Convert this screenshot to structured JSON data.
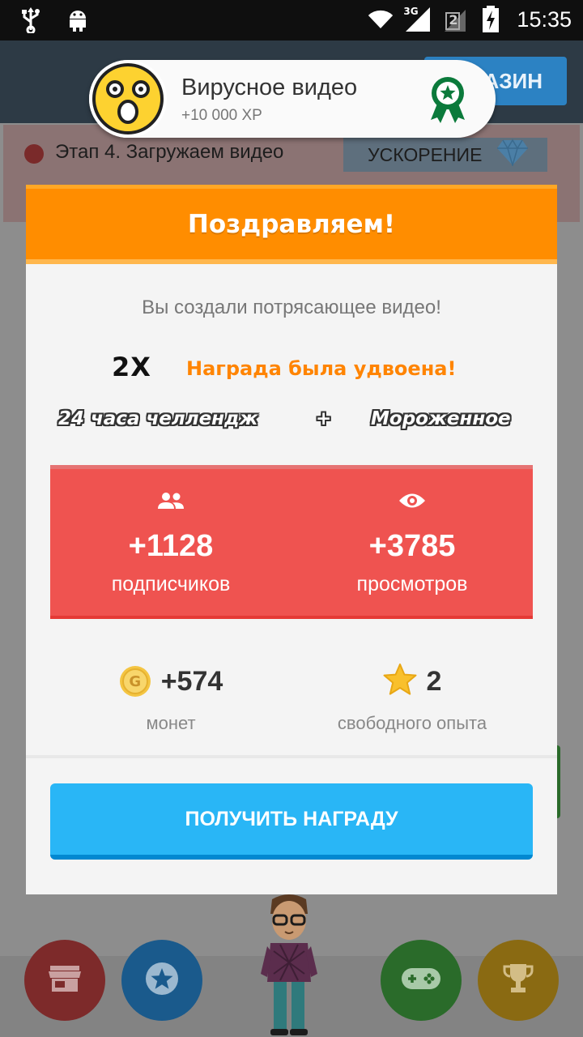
{
  "status_bar": {
    "time": "15:35",
    "network_label": "3G",
    "sim_label": "2",
    "icons": [
      "usb-icon",
      "android-debug-icon",
      "wifi-icon",
      "signal-icon",
      "sim-icon",
      "battery-charging-icon"
    ]
  },
  "header": {
    "shop_label": "АЗИН"
  },
  "stage": {
    "text": "Этап 4. Загружаем видео",
    "boost_label": "УСКОРЕНИЕ",
    "boost_icon": "diamond-icon"
  },
  "achievement_toast": {
    "title": "Вирусное видео",
    "reward": "+10 000 XP",
    "avatar_icon": "shocked-face-icon",
    "badge_icon": "award-ribbon-icon"
  },
  "dialog": {
    "title": "Поздравляем!",
    "subtitle": "Вы создали потрясающее видео!",
    "multiplier": "2X",
    "multiplier_text": "Награда была удвоена!",
    "combo": {
      "first": "24 часа челлендж",
      "plus": "+",
      "second": "Мороженное"
    },
    "stats": {
      "subscribers": {
        "value": "+1128",
        "label": "подписчиков",
        "icon": "people-icon"
      },
      "views": {
        "value": "+3785",
        "label": "просмотров",
        "icon": "eye-icon"
      }
    },
    "rewards": {
      "coins": {
        "value": "+574",
        "label": "монет",
        "icon": "coin-icon",
        "coin_letter": "G"
      },
      "xp": {
        "value": "2",
        "label": "свободного опыта",
        "icon": "star-icon"
      }
    },
    "claim_label": "ПОЛУЧИТЬ НАГРАДУ"
  },
  "bottom_nav": [
    {
      "name": "shop",
      "icon": "store-icon"
    },
    {
      "name": "favorites",
      "icon": "star-icon"
    },
    {
      "name": "games",
      "icon": "gamepad-icon"
    },
    {
      "name": "achievements",
      "icon": "trophy-icon"
    }
  ],
  "colors": {
    "dialog_header": "#ff8d00",
    "stats_panel": "#ef5350",
    "claim_button": "#29b6f6",
    "multiplier_text": "#ff8400"
  }
}
